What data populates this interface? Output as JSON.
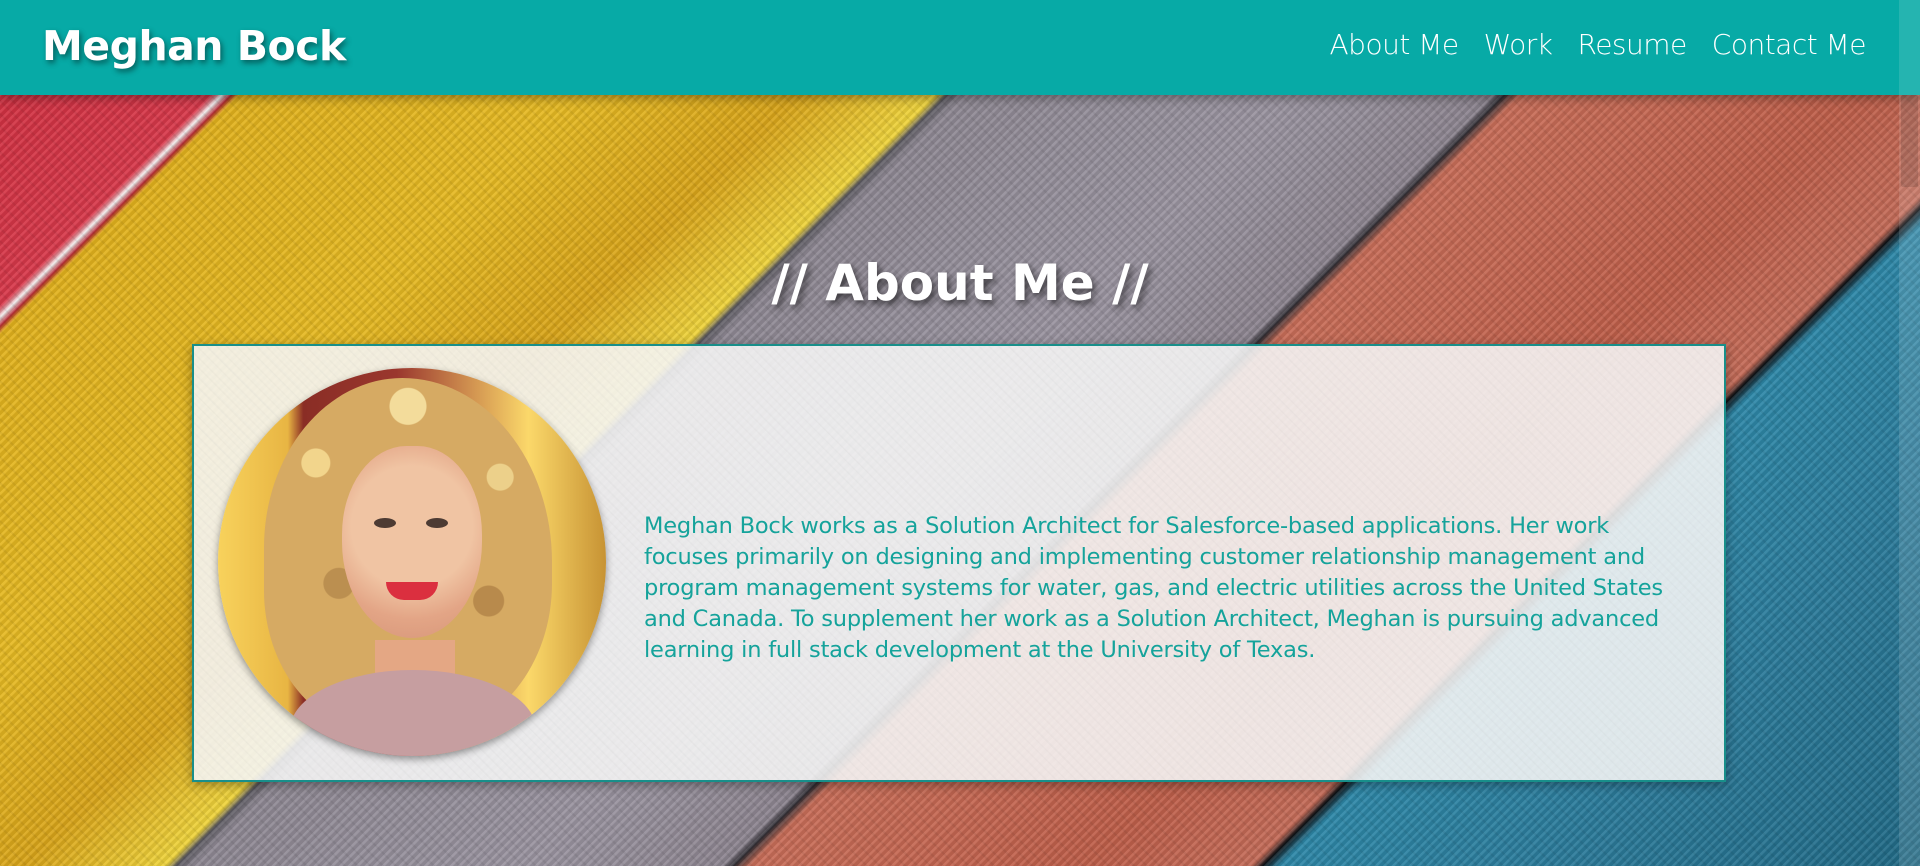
{
  "header": {
    "brand": "Meghan Bock",
    "nav": [
      {
        "label": "About Me"
      },
      {
        "label": "Work"
      },
      {
        "label": "Resume"
      },
      {
        "label": "Contact Me"
      }
    ]
  },
  "about": {
    "title": "// About Me //",
    "description": "Meghan Bock works as a Solution Architect for Salesforce-based applications. Her work focuses primarily on designing and implementing customer relationship management and program management systems for water, gas, and electric utilities across the United States and Canada. To supplement her work as a Solution Architect, Meghan is pursuing advanced learning in full stack development at the University of Texas."
  },
  "colors": {
    "header": "#07aaa6",
    "accent_text": "#15a39b",
    "card_border": "#188f8a"
  }
}
